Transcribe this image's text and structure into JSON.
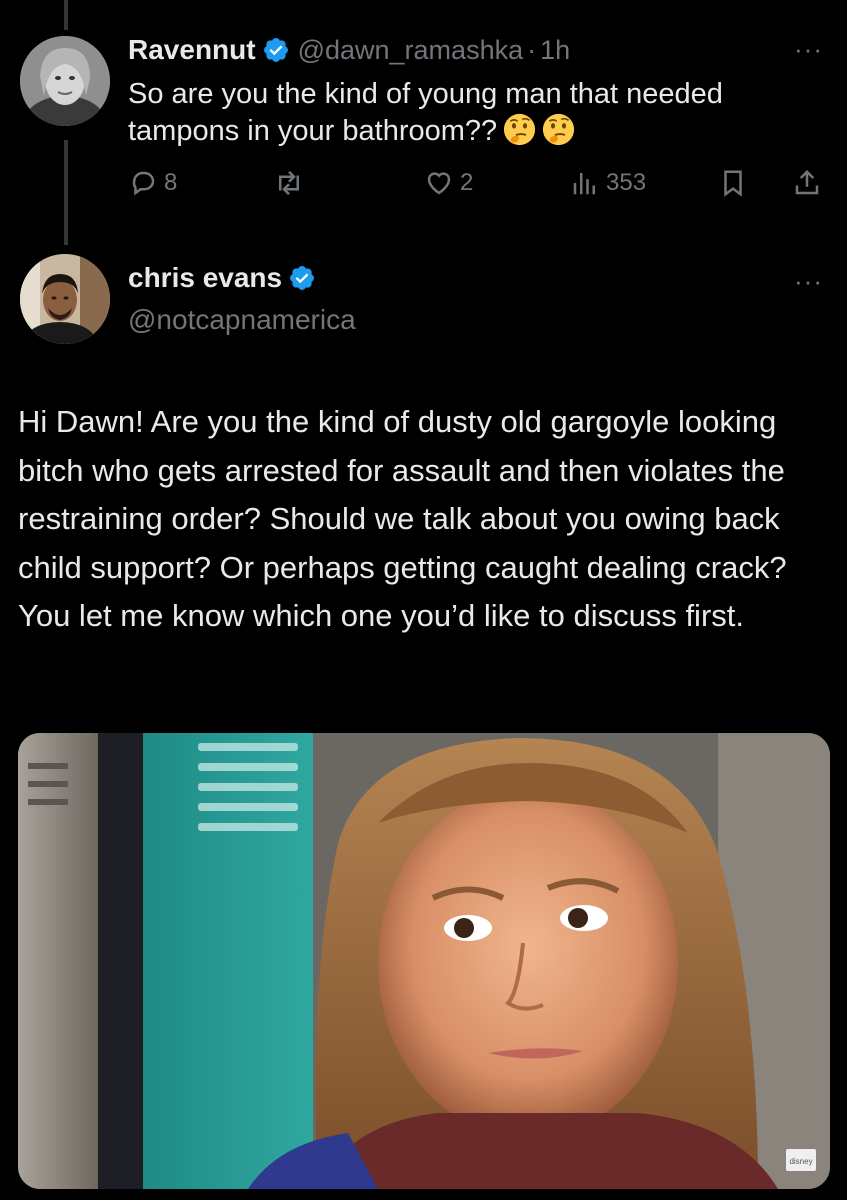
{
  "reply": {
    "author_name": "Ravennut",
    "author_handle": "@dawn_ramashka",
    "separator": "·",
    "time": "1h",
    "text": "So are you the kind of young man that needed tampons in your bathroom??",
    "emojis": [
      "thinking-face-emoji",
      "thinking-face-emoji"
    ],
    "stats": {
      "replies": "8",
      "likes": "2",
      "views": "353"
    }
  },
  "post": {
    "author_name": "chris evans",
    "author_handle": "@notcapnamerica",
    "text": "Hi Dawn! Are you the kind of dusty old gargoyle looking bitch who gets arrested for assault and then violates the restraining order? Should we talk about you owing back child support? Or perhaps getting caught dealing crack? You let me know which one you’d like to discuss first.",
    "media_watermark": "disney"
  },
  "ui": {
    "more_label": "···"
  },
  "colors": {
    "background": "#000000",
    "text": "#e7e9ea",
    "muted": "#71767b",
    "verified": "#1d9bf0",
    "thread_line": "#333639"
  }
}
